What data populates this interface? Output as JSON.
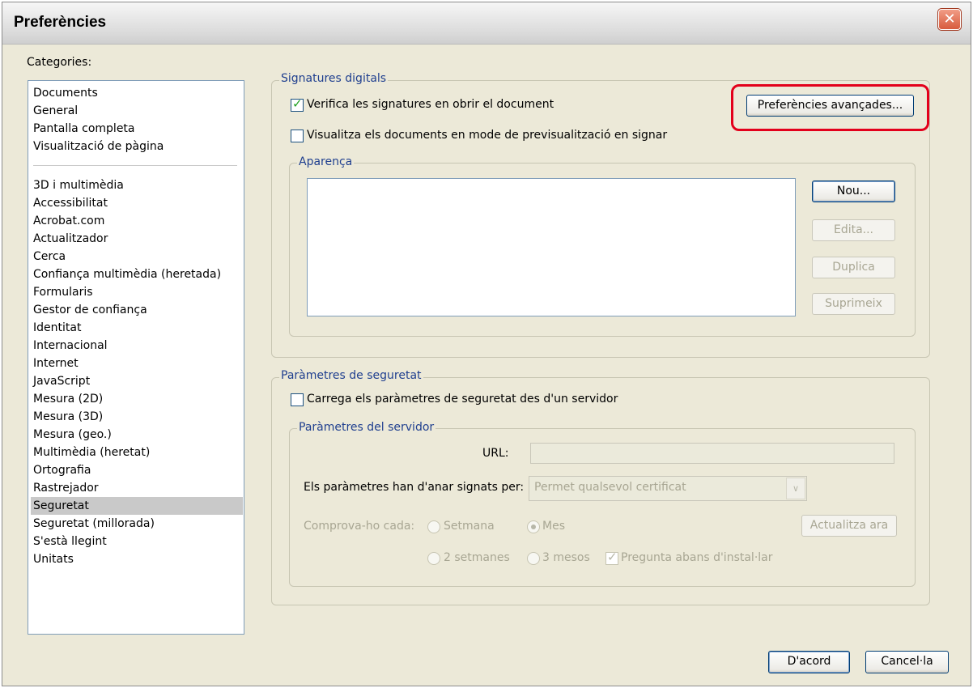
{
  "window": {
    "title": "Preferències",
    "close_glyph": "✕"
  },
  "categories": {
    "label": "Categories:",
    "group1": [
      "Documents",
      "General",
      "Pantalla completa",
      "Visualització de pàgina"
    ],
    "group2": [
      "3D i multimèdia",
      "Accessibilitat",
      "Acrobat.com",
      "Actualitzador",
      "Cerca",
      "Confiança multimèdia (heretada)",
      "Formularis",
      "Gestor de confiança",
      "Identitat",
      "Internacional",
      "Internet",
      "JavaScript",
      "Mesura (2D)",
      "Mesura (3D)",
      "Mesura (geo.)",
      "Multimèdia (heretat)",
      "Ortografia",
      "Rastrejador",
      "Seguretat",
      "Seguretat (millorada)",
      "S'està llegint",
      "Unitats"
    ],
    "selected": "Seguretat"
  },
  "digital_signatures": {
    "legend": "Signatures digitals",
    "verify_checkbox": {
      "label": "Verifica les signatures en obrir el document",
      "checked": true
    },
    "preview_checkbox": {
      "label": "Visualitza els documents en mode de previsualització en signar",
      "checked": false
    },
    "advanced_button": "Preferències avançades...",
    "appearance": {
      "legend": "Aparença",
      "new_button": "Nou...",
      "edit_button": "Edita...",
      "duplicate_button": "Duplica",
      "delete_button": "Suprimeix"
    }
  },
  "security_settings": {
    "legend": "Paràmetres de seguretat",
    "load_checkbox": {
      "label": "Carrega els paràmetres de seguretat des d'un servidor",
      "checked": false
    },
    "server": {
      "legend": "Paràmetres del servidor",
      "url_label": "URL:",
      "url_value": "",
      "signed_by_label": "Els paràmetres han d'anar signats per:",
      "signed_by_value": "Permet qualsevol certificat",
      "check_every_label": "Comprova-ho cada:",
      "options": {
        "week": "Setmana",
        "month": "Mes",
        "two_weeks": "2 setmanes",
        "three_months": "3 mesos"
      },
      "selected_option": "Mes",
      "ask_checkbox": {
        "label": "Pregunta abans d'instal·lar",
        "checked": true
      },
      "update_button": "Actualitza ara"
    }
  },
  "footer": {
    "ok_button": "D'acord",
    "cancel_button": "Cancel·la"
  },
  "colors": {
    "highlight": "#e3001b",
    "legend_text": "#1f3f8f",
    "selected_row": "#c9c9c9"
  }
}
